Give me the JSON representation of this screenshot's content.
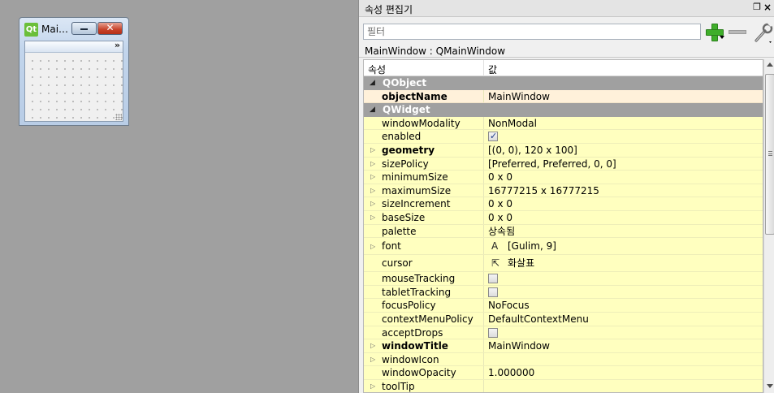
{
  "form_window": {
    "title": "Mai…",
    "logo_text": "Qt",
    "close_glyph": "✕",
    "toolbar_extension": "»"
  },
  "property_editor": {
    "dock_title": "속성 편집기",
    "filter_placeholder": "필터",
    "object_path": "MainWindow : QMainWindow",
    "header": {
      "property": "속성",
      "value": "값"
    },
    "groups": [
      {
        "name": "QObject",
        "properties": [
          {
            "name": "objectName",
            "value": "MainWindow",
            "bold": true,
            "changed": true
          }
        ]
      },
      {
        "name": "QWidget",
        "properties": [
          {
            "name": "windowModality",
            "value": "NonModal"
          },
          {
            "name": "enabled",
            "checkbox": true
          },
          {
            "name": "geometry",
            "value": "[(0, 0), 120 x 100]",
            "bold": true,
            "expandable": true
          },
          {
            "name": "sizePolicy",
            "value": "[Preferred, Preferred, 0, 0]",
            "expandable": true
          },
          {
            "name": "minimumSize",
            "value": "0 x 0",
            "expandable": true
          },
          {
            "name": "maximumSize",
            "value": "16777215 x 16777215",
            "expandable": true
          },
          {
            "name": "sizeIncrement",
            "value": "0 x 0",
            "expandable": true
          },
          {
            "name": "baseSize",
            "value": "0 x 0",
            "expandable": true
          },
          {
            "name": "palette",
            "value": "상속됨"
          },
          {
            "name": "font",
            "value": "[Gulim, 9]",
            "icon": "A",
            "icon_name": "font-icon",
            "expandable": true
          },
          {
            "name": "cursor",
            "value": "화살표",
            "icon": "⇱",
            "icon_name": "arrow-cursor-icon"
          },
          {
            "name": "mouseTracking",
            "checkbox": false
          },
          {
            "name": "tabletTracking",
            "checkbox": false
          },
          {
            "name": "focusPolicy",
            "value": "NoFocus"
          },
          {
            "name": "contextMenuPolicy",
            "value": "DefaultContextMenu"
          },
          {
            "name": "acceptDrops",
            "checkbox": false
          },
          {
            "name": "windowTitle",
            "value": "MainWindow",
            "bold": true,
            "expandable": true
          },
          {
            "name": "windowIcon",
            "value": "",
            "expandable": true
          },
          {
            "name": "windowOpacity",
            "value": "1.000000"
          },
          {
            "name": "toolTip",
            "value": "",
            "expandable": true
          }
        ]
      }
    ]
  },
  "colors": {
    "group_row": "#a0a0a0",
    "property_row": "#ffffbf",
    "changed_row": "#fff1da",
    "add_icon": "#3fae2a",
    "desktop": "#a0a0a0"
  }
}
